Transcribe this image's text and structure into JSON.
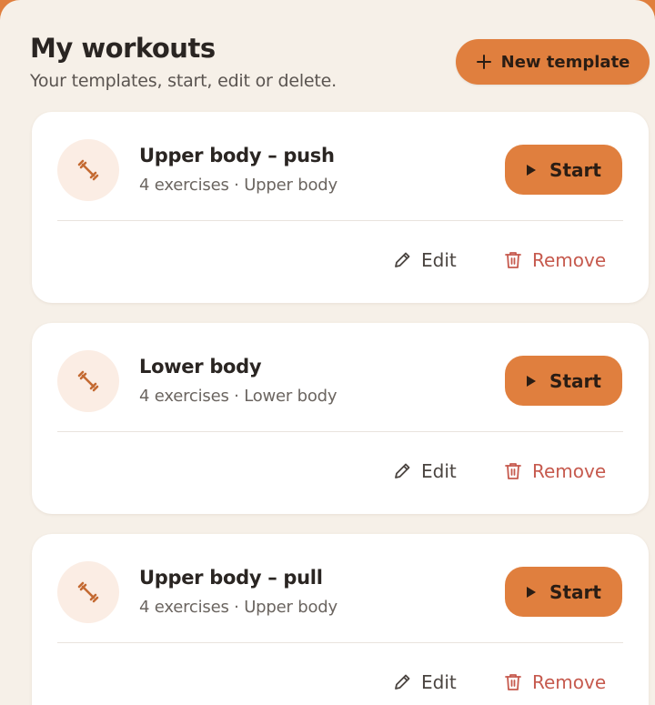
{
  "header": {
    "title": "My workouts",
    "subtitle": "Your templates, start, edit or delete.",
    "new_button_label": "New template",
    "new_button_icon": "plus-icon"
  },
  "colors": {
    "accent": "#e07f3e",
    "background": "#f6f0e8",
    "card": "#ffffff",
    "remove": "#c65a4e",
    "icon_bg": "#fbede4"
  },
  "workouts": [
    {
      "title": "Upper body – push",
      "meta": "4 exercises · Upper body",
      "icon": "dumbbell-icon",
      "start_label": "Start",
      "edit_label": "Edit",
      "remove_label": "Remove"
    },
    {
      "title": "Lower body",
      "meta": "4 exercises · Lower body",
      "icon": "dumbbell-icon",
      "start_label": "Start",
      "edit_label": "Edit",
      "remove_label": "Remove"
    },
    {
      "title": "Upper body – pull",
      "meta": "4 exercises · Upper body",
      "icon": "dumbbell-icon",
      "start_label": "Start",
      "edit_label": "Edit",
      "remove_label": "Remove"
    }
  ]
}
